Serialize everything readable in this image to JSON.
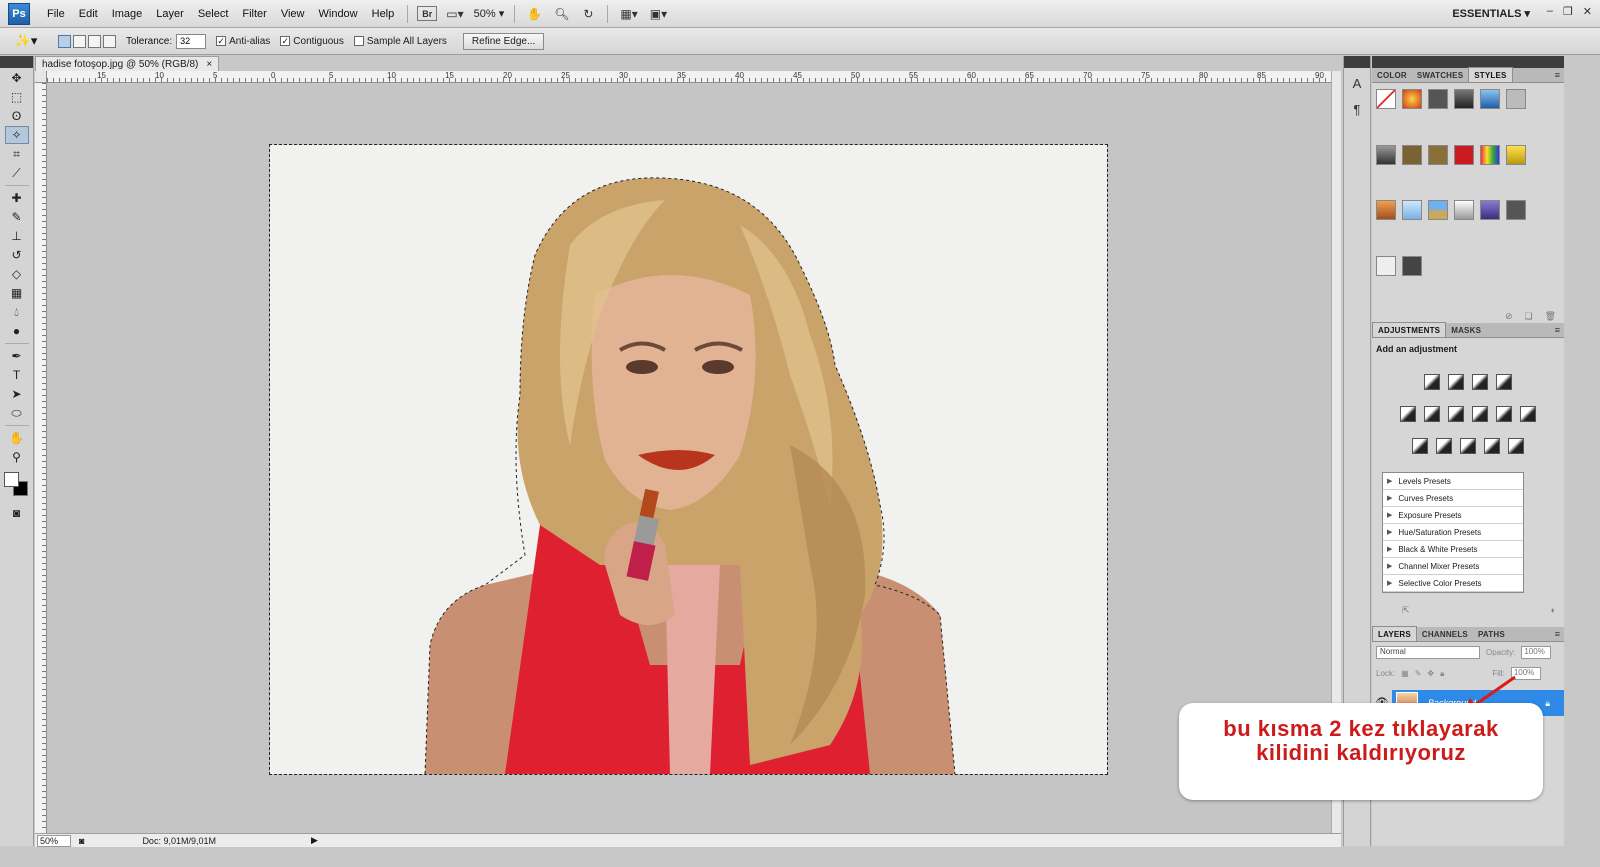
{
  "app": {
    "logo": "Ps",
    "workspace": "ESSENTIALS ▾"
  },
  "menu": [
    "File",
    "Edit",
    "Image",
    "Layer",
    "Select",
    "Filter",
    "View",
    "Window",
    "Help"
  ],
  "menubar_tools": {
    "bridge": "Br",
    "zoom": "50%"
  },
  "options": {
    "tolerance_label": "Tolerance:",
    "tolerance_value": "32",
    "antialias": "Anti-alias",
    "contiguous": "Contiguous",
    "sample_all": "Sample All Layers",
    "refine": "Refine Edge..."
  },
  "document": {
    "tab_title": "hadise fotoşop.jpg @ 50% (RGB/8)",
    "close": "×",
    "ruler_labels": [
      "15",
      "10",
      "5",
      "0",
      "5",
      "10",
      "15",
      "20",
      "25",
      "30",
      "35",
      "40",
      "45",
      "50",
      "55",
      "60",
      "65",
      "70",
      "75",
      "80",
      "85",
      "90"
    ],
    "status_zoom": "50%",
    "status_doc": "Doc: 9,01M/9,01M"
  },
  "panels": {
    "top_tabs": [
      "COLOR",
      "SWATCHES",
      "STYLES"
    ],
    "adjust_tabs": [
      "ADJUSTMENTS",
      "MASKS"
    ],
    "adjust_title": "Add an adjustment",
    "presets": [
      "Levels Presets",
      "Curves Presets",
      "Exposure Presets",
      "Hue/Saturation Presets",
      "Black & White Presets",
      "Channel Mixer Presets",
      "Selective Color Presets"
    ],
    "layer_tabs": [
      "LAYERS",
      "CHANNELS",
      "PATHS"
    ],
    "blend_mode": "Normal",
    "opacity_label": "Opacity:",
    "opacity": "100%",
    "lock_label": "Lock:",
    "fill_label": "Fill:",
    "fill": "100%",
    "layer_name": "Background"
  },
  "callout": {
    "line1": "bu kısma 2 kez tıklayarak",
    "line2": "kilidini kaldırıyoruz"
  },
  "colors": {
    "selection": "#2e8ae6",
    "callout_text": "#cc1b1b"
  }
}
